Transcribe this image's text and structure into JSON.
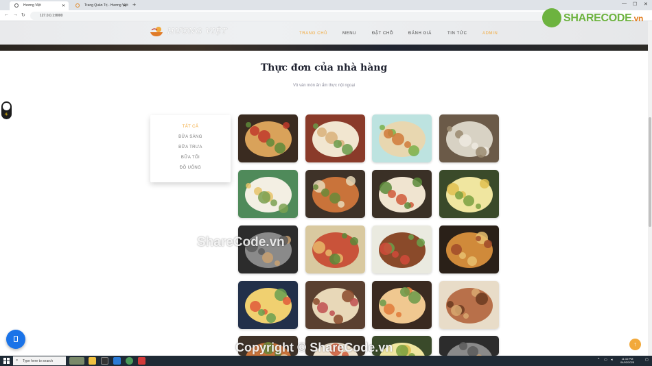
{
  "browser": {
    "tabs": [
      {
        "title": "Hương Việt",
        "active": true
      },
      {
        "title": "Trang Quản Trị - Hương Việt",
        "active": false
      }
    ],
    "new_tab": "+",
    "url": "127.0.0.1:8000"
  },
  "site": {
    "logo_text": "HƯƠNG VIỆT",
    "menu": [
      {
        "label": "TRANG CHỦ",
        "active": true
      },
      {
        "label": "MENU",
        "active": false
      },
      {
        "label": "ĐẶT CHỖ",
        "active": false
      },
      {
        "label": "ĐÁNH GIÁ",
        "active": false
      },
      {
        "label": "TIN TỨC",
        "active": false
      },
      {
        "label": "ADMIN",
        "active": true
      }
    ],
    "accent_color": "#f2a93b"
  },
  "section": {
    "title": "Thực đơn của nhà hàng",
    "subtitle": "Vô vàn món ăn ẩm thực nội ngoại"
  },
  "categories": [
    {
      "label": "TẤT CẢ",
      "active": true
    },
    {
      "label": "BỮA SÁNG",
      "active": false
    },
    {
      "label": "BỮA TRƯA",
      "active": false
    },
    {
      "label": "BỮA TỐI",
      "active": false
    },
    {
      "label": "ĐỒ UỐNG",
      "active": false
    }
  ],
  "dishes": [
    "banh-mi",
    "nem-cuon",
    "goi-cuon-trung",
    "chao",
    "pho",
    "bun-dau",
    "goi-cuon",
    "bun-ga",
    "lau-hai-san",
    "banh-mi-thit",
    "com-suon",
    "ca-ri-ga",
    "com-chien",
    "bun-bo",
    "mi-xao-hai-san",
    "thit-kho"
  ],
  "watermarks": {
    "center": "ShareCode.vn",
    "bottom": "Copyright © ShareCode.vn",
    "brand": "SHARECODE",
    "brand_suffix": ".vn"
  },
  "taskbar": {
    "search_placeholder": "Type here to search",
    "time": "11:10 PM",
    "date": "04/02/2025"
  }
}
